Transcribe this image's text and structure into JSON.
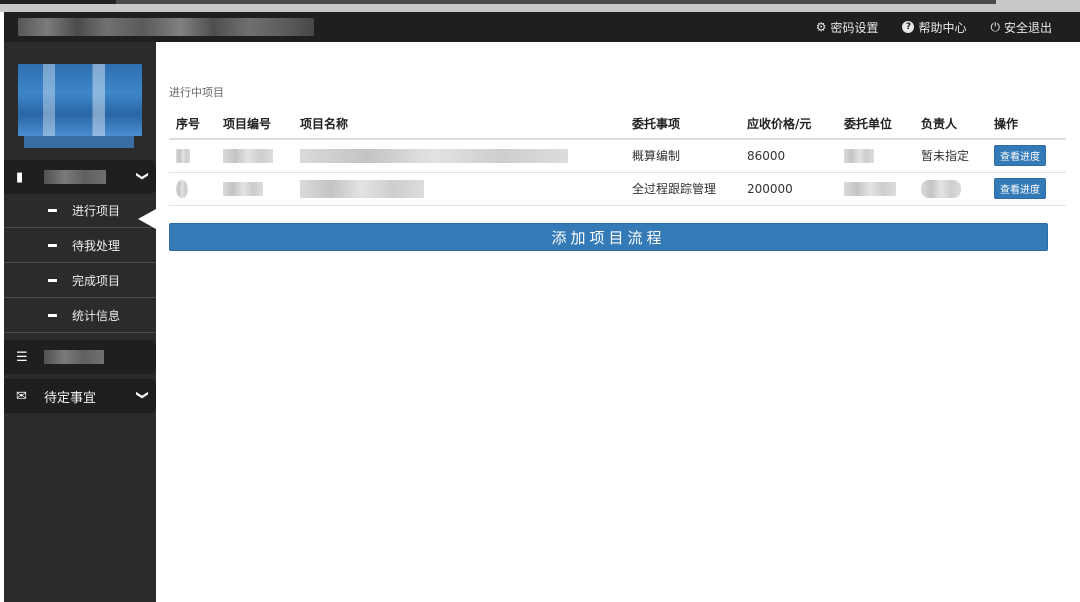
{
  "topbar": {
    "links": [
      {
        "icon": "gear-icon",
        "glyph": "⚙",
        "label": "密码设置"
      },
      {
        "icon": "help-icon",
        "glyph": "?",
        "label": "帮助中心"
      },
      {
        "icon": "power-icon",
        "glyph": "⏻",
        "label": "安全退出"
      }
    ]
  },
  "sidebar": {
    "group1": {
      "icon": "book-icon",
      "glyph": "▮"
    },
    "sub_items": [
      {
        "label": "进行项目"
      },
      {
        "label": "待我处理"
      },
      {
        "label": "完成项目"
      },
      {
        "label": "统计信息"
      }
    ],
    "group2": {
      "icon": "list-icon",
      "glyph": "☰"
    },
    "group3": {
      "icon": "envelope-icon",
      "glyph": "✉",
      "label": "待定事宜"
    },
    "chevron": "❯"
  },
  "main": {
    "section_title": "进行中项目",
    "table": {
      "headers": [
        "序号",
        "项目编号",
        "项目名称",
        "委托事项",
        "应收价格/元",
        "委托单位",
        "负责人",
        "操作"
      ],
      "rows": [
        {
          "matter": "概算编制",
          "price": "86000",
          "owner": "暂未指定",
          "action": "查看进度"
        },
        {
          "matter": "全过程跟踪管理",
          "price": "200000",
          "owner": "",
          "action": "查看进度"
        }
      ]
    },
    "add_button": "添加项目流程"
  },
  "colors": {
    "topbar": "#1f1f1f",
    "sidebar": "#2b2b2b",
    "accent": "#337ab7"
  }
}
